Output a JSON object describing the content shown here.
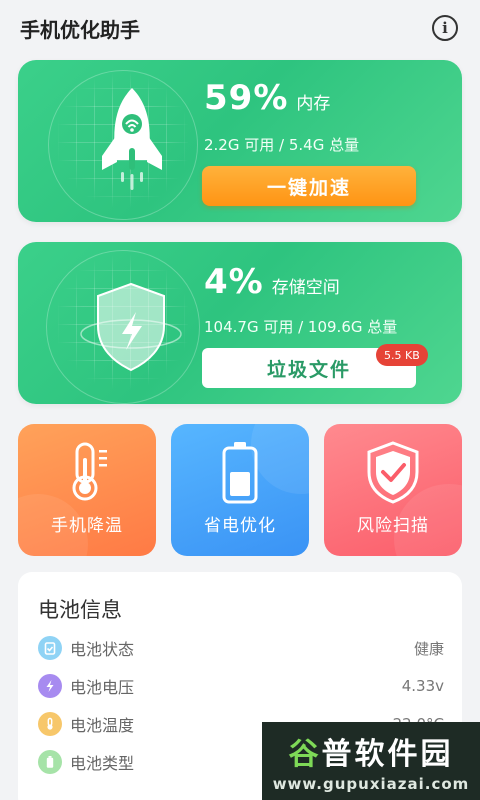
{
  "header": {
    "title": "手机优化助手",
    "info_icon": "info-icon",
    "info_glyph": "i"
  },
  "memory": {
    "percent": "59%",
    "label": "内存",
    "usage": "2.2G 可用 / 5.4G 总量",
    "button": "一键加速",
    "icon": "rocket-icon"
  },
  "storage": {
    "percent": "4%",
    "label": "存储空间",
    "usage": "104.7G 可用 / 109.6G 总量",
    "button": "垃圾文件",
    "badge": "5.5 KB",
    "icon": "shield-bolt-icon"
  },
  "tiles": [
    {
      "label": "手机降温",
      "icon": "thermometer-icon",
      "color": "#ff8a4c"
    },
    {
      "label": "省电优化",
      "icon": "battery-icon",
      "color": "#4aa6fb"
    },
    {
      "label": "风险扫描",
      "icon": "shield-check-icon",
      "color": "#fc6f78"
    }
  ],
  "battery": {
    "title": "电池信息",
    "rows": [
      {
        "label": "电池状态",
        "value": "健康",
        "icon": "clipboard-icon",
        "color": "#8fd3f5"
      },
      {
        "label": "电池电压",
        "value": "4.33v",
        "icon": "bolt-icon",
        "color": "#a78bf0"
      },
      {
        "label": "电池温度",
        "value": "22.0°C",
        "icon": "thermo-icon",
        "color": "#f7c76a"
      },
      {
        "label": "电池类型",
        "value": "",
        "icon": "battery-small-icon",
        "color": "#a6e3a8"
      }
    ]
  },
  "watermark": {
    "brand_first": "谷",
    "brand_rest": "普软件园",
    "url": "www.gupuxiazai.com"
  },
  "colors": {
    "green_card": "#34c884",
    "orange_button": "#ff9a1e",
    "badge_red": "#e64337"
  }
}
